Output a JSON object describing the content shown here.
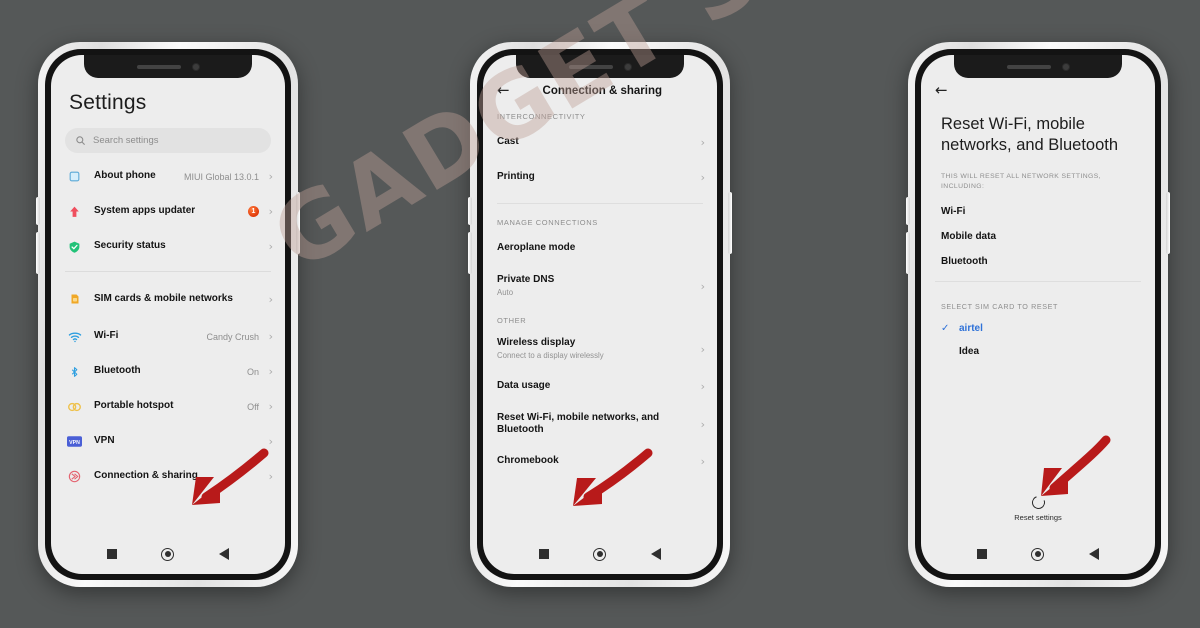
{
  "meta": {
    "background_color": "#555858",
    "watermark": "GADGET SKOOL",
    "accent_blue": "#2f72d8",
    "arrow_color": "#b81a1a"
  },
  "phone1": {
    "title": "Settings",
    "search": {
      "placeholder": "Search settings",
      "icon": "search-icon"
    },
    "group1": [
      {
        "icon": "about-phone-icon",
        "label": "About phone",
        "value": "MIUI Global 13.0.1",
        "chevron": "›"
      },
      {
        "icon": "system-updater-icon",
        "label": "System apps updater",
        "value": "",
        "badge": "1",
        "chevron": "›"
      },
      {
        "icon": "security-shield-icon",
        "label": "Security status",
        "value": "",
        "chevron": "›"
      }
    ],
    "group2": [
      {
        "icon": "sim-card-icon",
        "label": "SIM cards & mobile networks",
        "value": "",
        "chevron": "›"
      },
      {
        "icon": "wifi-icon",
        "label": "Wi-Fi",
        "value": "Candy Crush",
        "chevron": "›"
      },
      {
        "icon": "bluetooth-icon",
        "label": "Bluetooth",
        "value": "On",
        "chevron": "›"
      },
      {
        "icon": "hotspot-icon",
        "label": "Portable hotspot",
        "value": "Off",
        "chevron": "›"
      },
      {
        "icon": "vpn-icon",
        "label": "VPN",
        "value": "",
        "chevron": "›"
      },
      {
        "icon": "connection-sharing-icon",
        "label": "Connection & sharing",
        "value": "",
        "chevron": "›"
      }
    ]
  },
  "phone2": {
    "back": "←",
    "title": "Connection & sharing",
    "section1_header": "INTERCONNECTIVITY",
    "section1": [
      {
        "label": "Cast",
        "sub": "",
        "chevron": "›"
      },
      {
        "label": "Printing",
        "sub": "",
        "chevron": "›"
      }
    ],
    "section2_header": "MANAGE CONNECTIONS",
    "section2": [
      {
        "label": "Aeroplane mode",
        "sub": "",
        "chevron": ""
      },
      {
        "label": "Private DNS",
        "sub": "Auto",
        "chevron": "›"
      }
    ],
    "section3_header": "OTHER",
    "section3": [
      {
        "label": "Wireless display",
        "sub": "Connect to a display wirelessly",
        "chevron": "›"
      },
      {
        "label": "Data usage",
        "sub": "",
        "chevron": "›"
      },
      {
        "label": "Reset Wi-Fi, mobile networks, and Bluetooth",
        "sub": "",
        "chevron": "›"
      },
      {
        "label": "Chromebook",
        "sub": "",
        "chevron": "›"
      }
    ]
  },
  "phone3": {
    "back": "←",
    "title": "Reset Wi-Fi, mobile networks, and Bluetooth",
    "note": "THIS WILL RESET ALL NETWORK SETTINGS, INCLUDING:",
    "items": [
      "Wi-Fi",
      "Mobile data",
      "Bluetooth"
    ],
    "sim_header": "SELECT SIM CARD TO RESET",
    "sims": [
      {
        "name": "airtel",
        "selected": true,
        "check": "✓"
      },
      {
        "name": "Idea",
        "selected": false,
        "check": ""
      }
    ],
    "reset_button_label": "Reset settings"
  },
  "navbar": {
    "recents": "recents-square-icon",
    "home": "home-circle-icon",
    "back": "back-triangle-icon"
  }
}
